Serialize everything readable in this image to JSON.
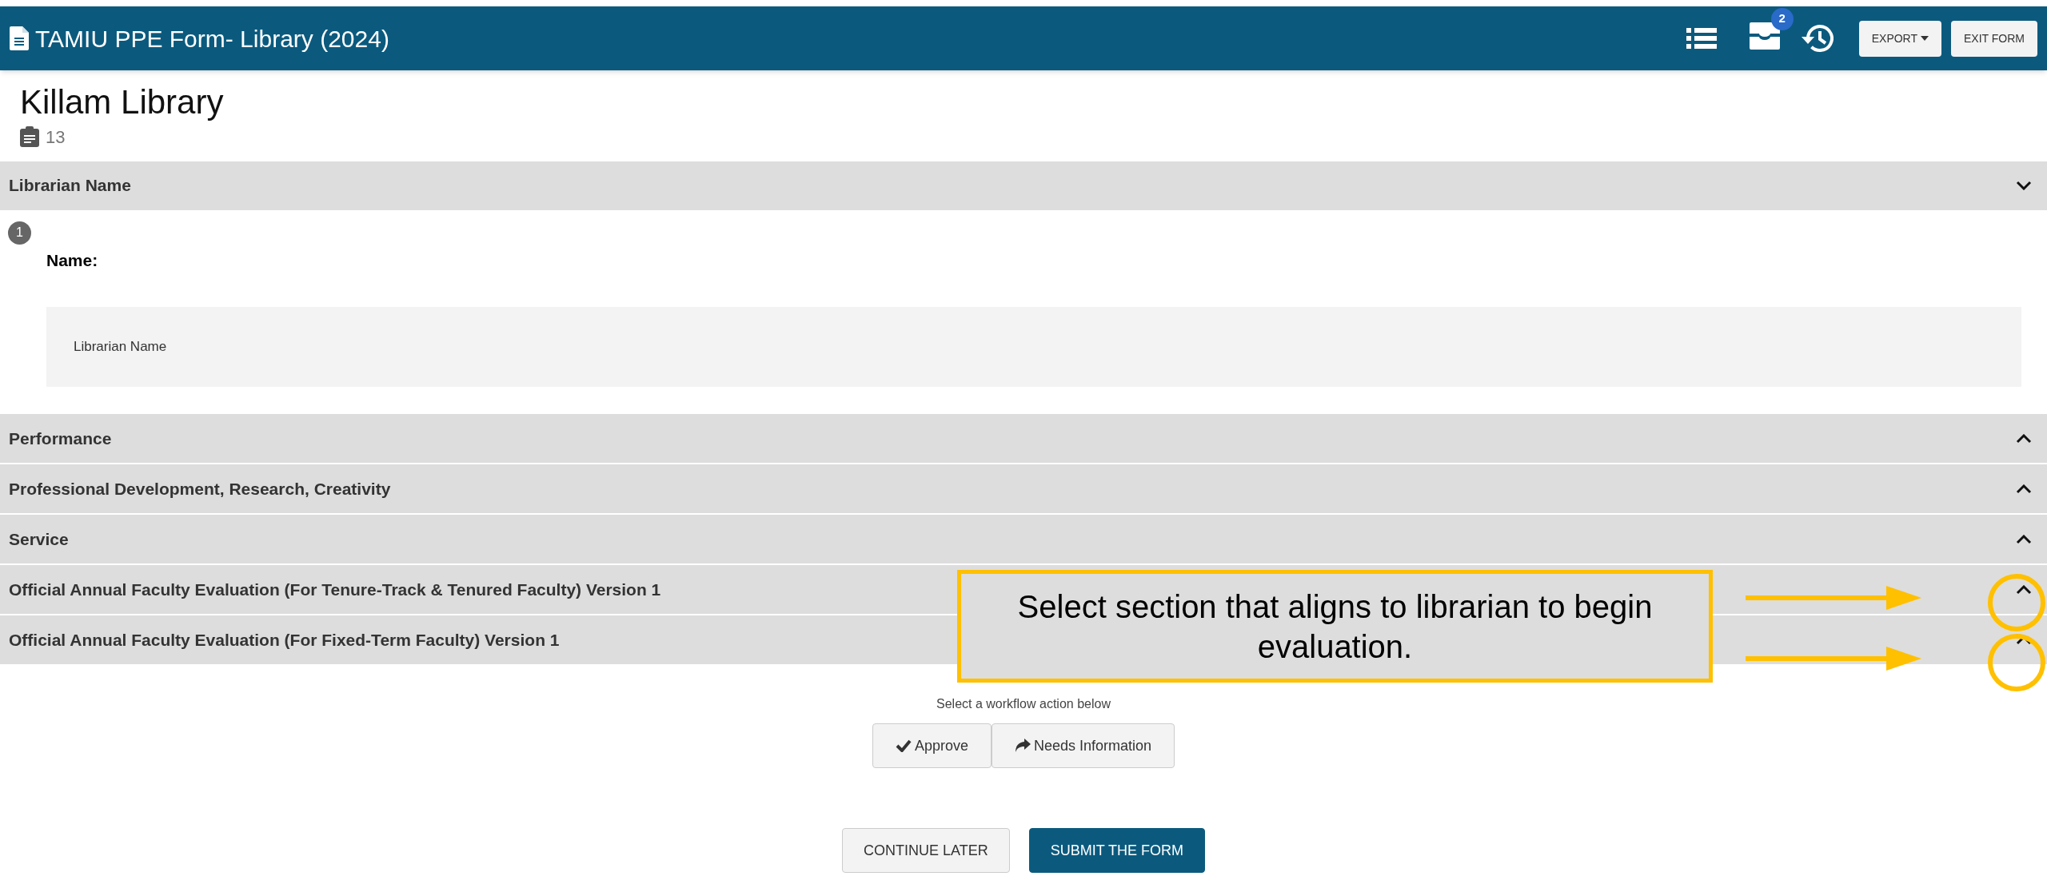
{
  "header": {
    "title": "TAMIU PPE Form- Library (2024)",
    "inbox_badge": "2",
    "buttons": [
      {
        "label": "EXPORT",
        "kind": "dropdown"
      },
      {
        "label": "EXIT FORM",
        "kind": "plain"
      }
    ]
  },
  "page": {
    "title": "Killam Library",
    "count": "13"
  },
  "sections": [
    {
      "title": "Librarian Name",
      "expanded": true,
      "questions": [
        {
          "number": "1",
          "label": "Name:",
          "value": "Librarian Name"
        }
      ]
    },
    {
      "title": "Performance",
      "expanded": false
    },
    {
      "title": "Professional Development, Research, Creativity",
      "expanded": false
    },
    {
      "title": "Service",
      "expanded": false
    },
    {
      "title": "Official Annual Faculty Evaluation (For Tenure-Track & Tenured Faculty) Version 1",
      "expanded": false
    },
    {
      "title": "Official Annual Faculty Evaluation (For Fixed-Term Faculty) Version 1",
      "expanded": false
    }
  ],
  "workflow": {
    "prompt": "Select a workflow action below",
    "actions": [
      {
        "label": "Approve",
        "kind": "approve"
      },
      {
        "label": "Needs Information",
        "kind": "forward"
      }
    ]
  },
  "footer_buttons": [
    {
      "label": "CONTINUE LATER",
      "kind": "secondary"
    },
    {
      "label": "SUBMIT THE FORM",
      "kind": "primary"
    }
  ],
  "annotation": {
    "text": "Select section that aligns to librarian to begin evaluation."
  }
}
